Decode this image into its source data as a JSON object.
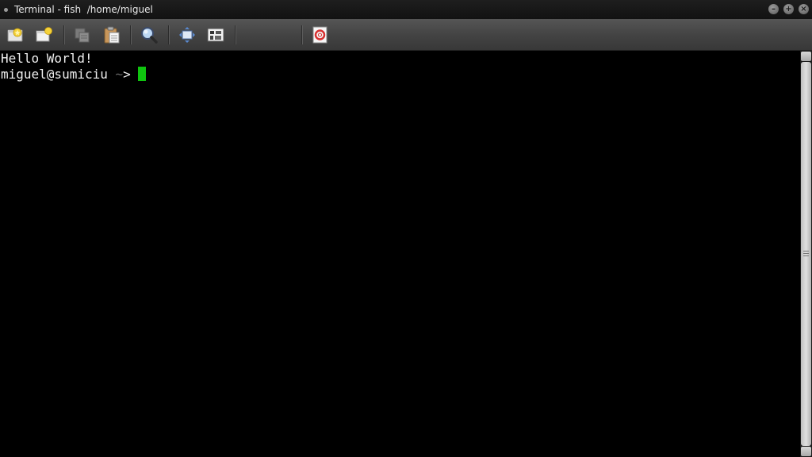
{
  "window": {
    "title": "Terminal - fish  /home/miguel",
    "controls": [
      "minimize",
      "maximize",
      "close"
    ]
  },
  "toolbar": {
    "buttons": [
      {
        "name": "new-tab",
        "icon": "new-tab-icon"
      },
      {
        "name": "new-window",
        "icon": "new-window-icon"
      },
      {
        "name": "copy",
        "icon": "copy-icon"
      },
      {
        "name": "paste",
        "icon": "paste-icon"
      },
      {
        "name": "find",
        "icon": "search-icon"
      },
      {
        "name": "fullscreen",
        "icon": "fullscreen-icon"
      },
      {
        "name": "preferences",
        "icon": "preferences-icon"
      },
      {
        "name": "help",
        "icon": "lifebuoy-icon"
      }
    ]
  },
  "terminal": {
    "lines": [
      {
        "text": "Hello World!"
      }
    ],
    "prompt": {
      "user_host": "miguel@sumiciu",
      "path": "~",
      "arrow": ">"
    },
    "cursor_color": "#0fc40f",
    "background_color": "#000000",
    "foreground_color": "#f0f0f0"
  }
}
